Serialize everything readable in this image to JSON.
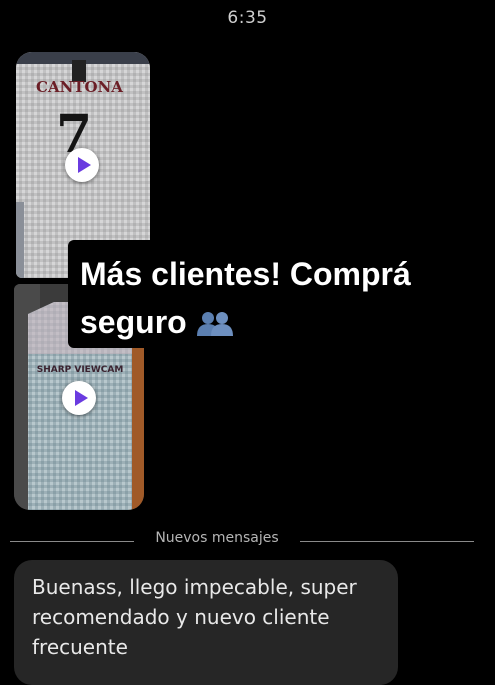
{
  "status_bar": {
    "time": "6:35"
  },
  "media": [
    {
      "jersey_name": "CANTONA",
      "jersey_number": "7",
      "type": "video"
    },
    {
      "jersey_name": "SHARP VIEWCAM",
      "type": "video"
    }
  ],
  "overlay": {
    "text": "Más clientes! Comprá seguro",
    "icon": "people-icon"
  },
  "divider": {
    "label": "Nuevos mensajes"
  },
  "message": {
    "text": "Buenass, llego impecable, super recomendado y nuevo cliente frecuente"
  },
  "colors": {
    "background": "#000000",
    "bubble": "#262626",
    "play_accent": "#6a3be0",
    "icon_blue": "#5b7fb0"
  }
}
